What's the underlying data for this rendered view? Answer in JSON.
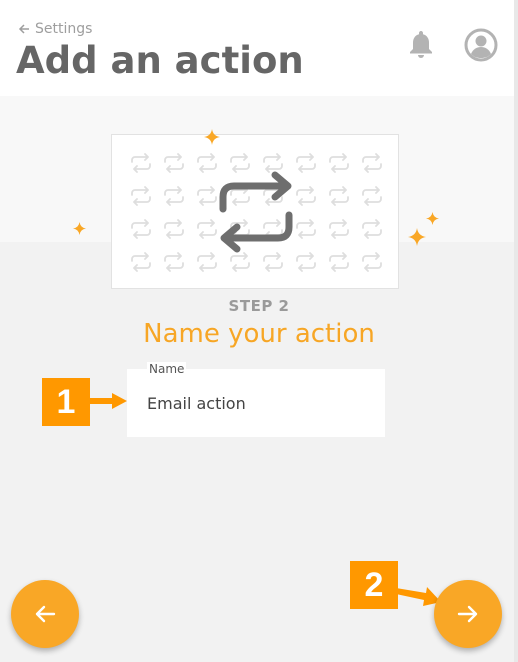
{
  "header": {
    "back_label": "Settings",
    "title": "Add an action"
  },
  "step": {
    "label": "STEP 2",
    "heading": "Name your action"
  },
  "form": {
    "name_label": "Name",
    "name_value": "Email action"
  },
  "callouts": [
    "1",
    "2"
  ],
  "icons": {
    "back": "arrow-left-icon",
    "notifications": "bell-icon",
    "account": "user-avatar-icon",
    "hero": "repeat-arrows-icon",
    "sparkle": "sparkle-icon",
    "prev": "arrow-left-icon",
    "next": "arrow-right-icon"
  },
  "colors": {
    "accent": "#f9a726",
    "callout": "#ff9800",
    "title": "#666666",
    "icon_gray": "#b3b3b3"
  }
}
